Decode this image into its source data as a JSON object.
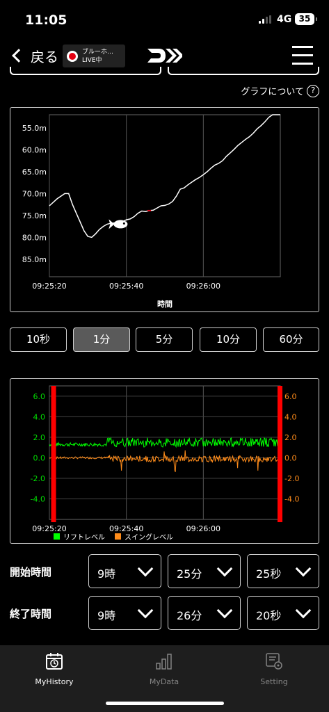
{
  "status": {
    "time": "11:05",
    "network": "4G",
    "battery": "35"
  },
  "nav": {
    "back_label": "戻る",
    "live_line1": "ブルーホ…",
    "live_line2": "LIVE中",
    "live_color": "#e60012"
  },
  "about_label": "グラフについて",
  "about_icon_text": "?",
  "chart_data": [
    {
      "type": "line",
      "xlabel": "時間",
      "y_ticks": [
        "55.0m",
        "60.0m",
        "65.0m",
        "70.0m",
        "75.0m",
        "80.0m",
        "85.0m"
      ],
      "x_ticks": [
        "09:25:20",
        "09:25:40",
        "09:26:00"
      ],
      "ylim": [
        52,
        89
      ],
      "y_inverted": true,
      "x_unit": "seconds after 09:25:20",
      "x": [
        0,
        2,
        4,
        5,
        6,
        7,
        8,
        9,
        10,
        11,
        12,
        13,
        14,
        15,
        16,
        17,
        18,
        19,
        20,
        21,
        22,
        23,
        24,
        25,
        26,
        27,
        28,
        29,
        30,
        31,
        32,
        33,
        34,
        35,
        36,
        37,
        38,
        39,
        40,
        41,
        42,
        43,
        44,
        45,
        46,
        47,
        48,
        49,
        50,
        51,
        52,
        53,
        54,
        55,
        56,
        57,
        58,
        59,
        60,
        61,
        62,
        63,
        64,
        65
      ],
      "y": [
        72.8,
        71.2,
        70.0,
        70.0,
        72.5,
        74.5,
        76.5,
        78.5,
        79.8,
        80.0,
        79.2,
        78.2,
        77.5,
        77.0,
        76.8,
        76.7,
        76.8,
        76.4,
        76.0,
        75.8,
        75.3,
        74.5,
        74.0,
        74.1,
        73.9,
        73.8,
        73.3,
        72.8,
        72.7,
        72.4,
        71.8,
        70.6,
        69.0,
        68.7,
        68.0,
        67.4,
        66.8,
        66.3,
        65.7,
        65.0,
        64.2,
        63.5,
        63.1,
        62.5,
        61.5,
        60.7,
        59.9,
        59.0,
        58.3,
        57.6,
        57.0,
        56.2,
        55.2,
        54.5,
        53.6,
        52.6,
        51.6,
        50.5,
        49.8,
        48.5,
        47.2,
        45.9,
        44.6,
        43.2
      ],
      "line_color": "#ffffff",
      "marker": "fish-icon",
      "marker_x": 18.5,
      "marker_y": 77.0,
      "red_marker_x": 25.5
    },
    {
      "type": "line",
      "y_ticks_left": [
        "6.0",
        "4.0",
        "2.0",
        "0.0",
        "-2.0",
        "-4.0"
      ],
      "y_ticks_right": [
        "6.0",
        "4.0",
        "2.0",
        "0.0",
        "-2.0",
        "-4.0"
      ],
      "x_ticks": [
        "09:25:20",
        "09:25:40",
        "09:26:00"
      ],
      "ylim": [
        -6,
        7
      ],
      "x_unit": "seconds after 09:25:20",
      "series": [
        {
          "name": "リフトレベル",
          "color": "#00ff00",
          "x": [
            0,
            65
          ],
          "y": [
            1.3,
            1.35
          ]
        },
        {
          "name": "スイングレベル",
          "color": "#ff8c1a",
          "x": [
            0,
            65
          ],
          "y": [
            0.0,
            0.0
          ]
        }
      ],
      "red_bars": [
        1,
        64
      ]
    }
  ],
  "range_buttons": [
    "10秒",
    "1分",
    "5分",
    "10分",
    "60分"
  ],
  "range_selected": "1分",
  "start": {
    "label": "開始時間",
    "hour": "9時",
    "minute": "25分",
    "second": "25秒"
  },
  "end": {
    "label": "終了時間",
    "hour": "9時",
    "minute": "26分",
    "second": "20秒"
  },
  "tabs": [
    {
      "label": "MyHistory",
      "icon": "calendar-clock-icon",
      "active": true
    },
    {
      "label": "MyData",
      "icon": "bar-chart-icon",
      "active": false
    },
    {
      "label": "Setting",
      "icon": "settings-list-icon",
      "active": false
    }
  ]
}
